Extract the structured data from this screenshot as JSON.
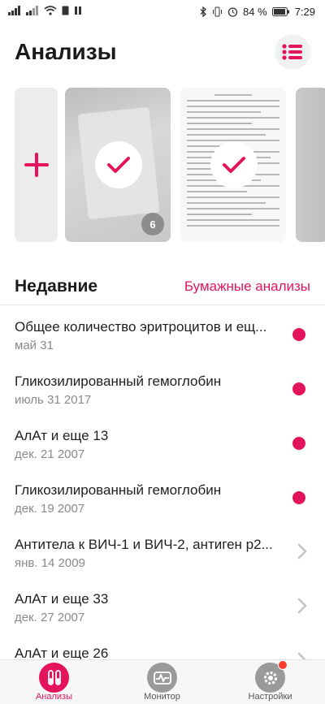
{
  "status_bar": {
    "battery": "84 %",
    "time": "7:29"
  },
  "header": {
    "title": "Анализы"
  },
  "carousel": {
    "cards": [
      {
        "type": "add"
      },
      {
        "type": "photo",
        "checked": true,
        "count": "6"
      },
      {
        "type": "document",
        "checked": true
      },
      {
        "type": "photo"
      }
    ]
  },
  "recent": {
    "title": "Недавние",
    "paper_link": "Бумажные анализы",
    "items": [
      {
        "title": "Общее количество эритроцитов и ещ...",
        "date": "май 31",
        "indicator": "dot"
      },
      {
        "title": "Гликозилированный гемоглобин",
        "date": "июль 31 2017",
        "indicator": "dot"
      },
      {
        "title": "АлАт и еще 13",
        "date": "дек. 21 2007",
        "indicator": "dot"
      },
      {
        "title": "Гликозилированный гемоглобин",
        "date": "дек. 19 2007",
        "indicator": "dot"
      },
      {
        "title": "Антитела к ВИЧ-1 и ВИЧ-2, антиген p2...",
        "date": "янв. 14 2009",
        "indicator": "chevron"
      },
      {
        "title": "АлАт и еще 33",
        "date": "дек. 27 2007",
        "indicator": "chevron"
      },
      {
        "title": "АлАт и еще 26",
        "date": "",
        "indicator": "chevron"
      }
    ]
  },
  "nav": {
    "items": [
      {
        "label": "Анализы",
        "icon": "test-tubes-icon",
        "active": true
      },
      {
        "label": "Монитор",
        "icon": "monitor-pulse-icon",
        "active": false
      },
      {
        "label": "Настройки",
        "icon": "gear-icon",
        "active": false,
        "notification": true
      }
    ]
  },
  "colors": {
    "accent": "#e4145c",
    "muted": "#8a8a8a"
  }
}
